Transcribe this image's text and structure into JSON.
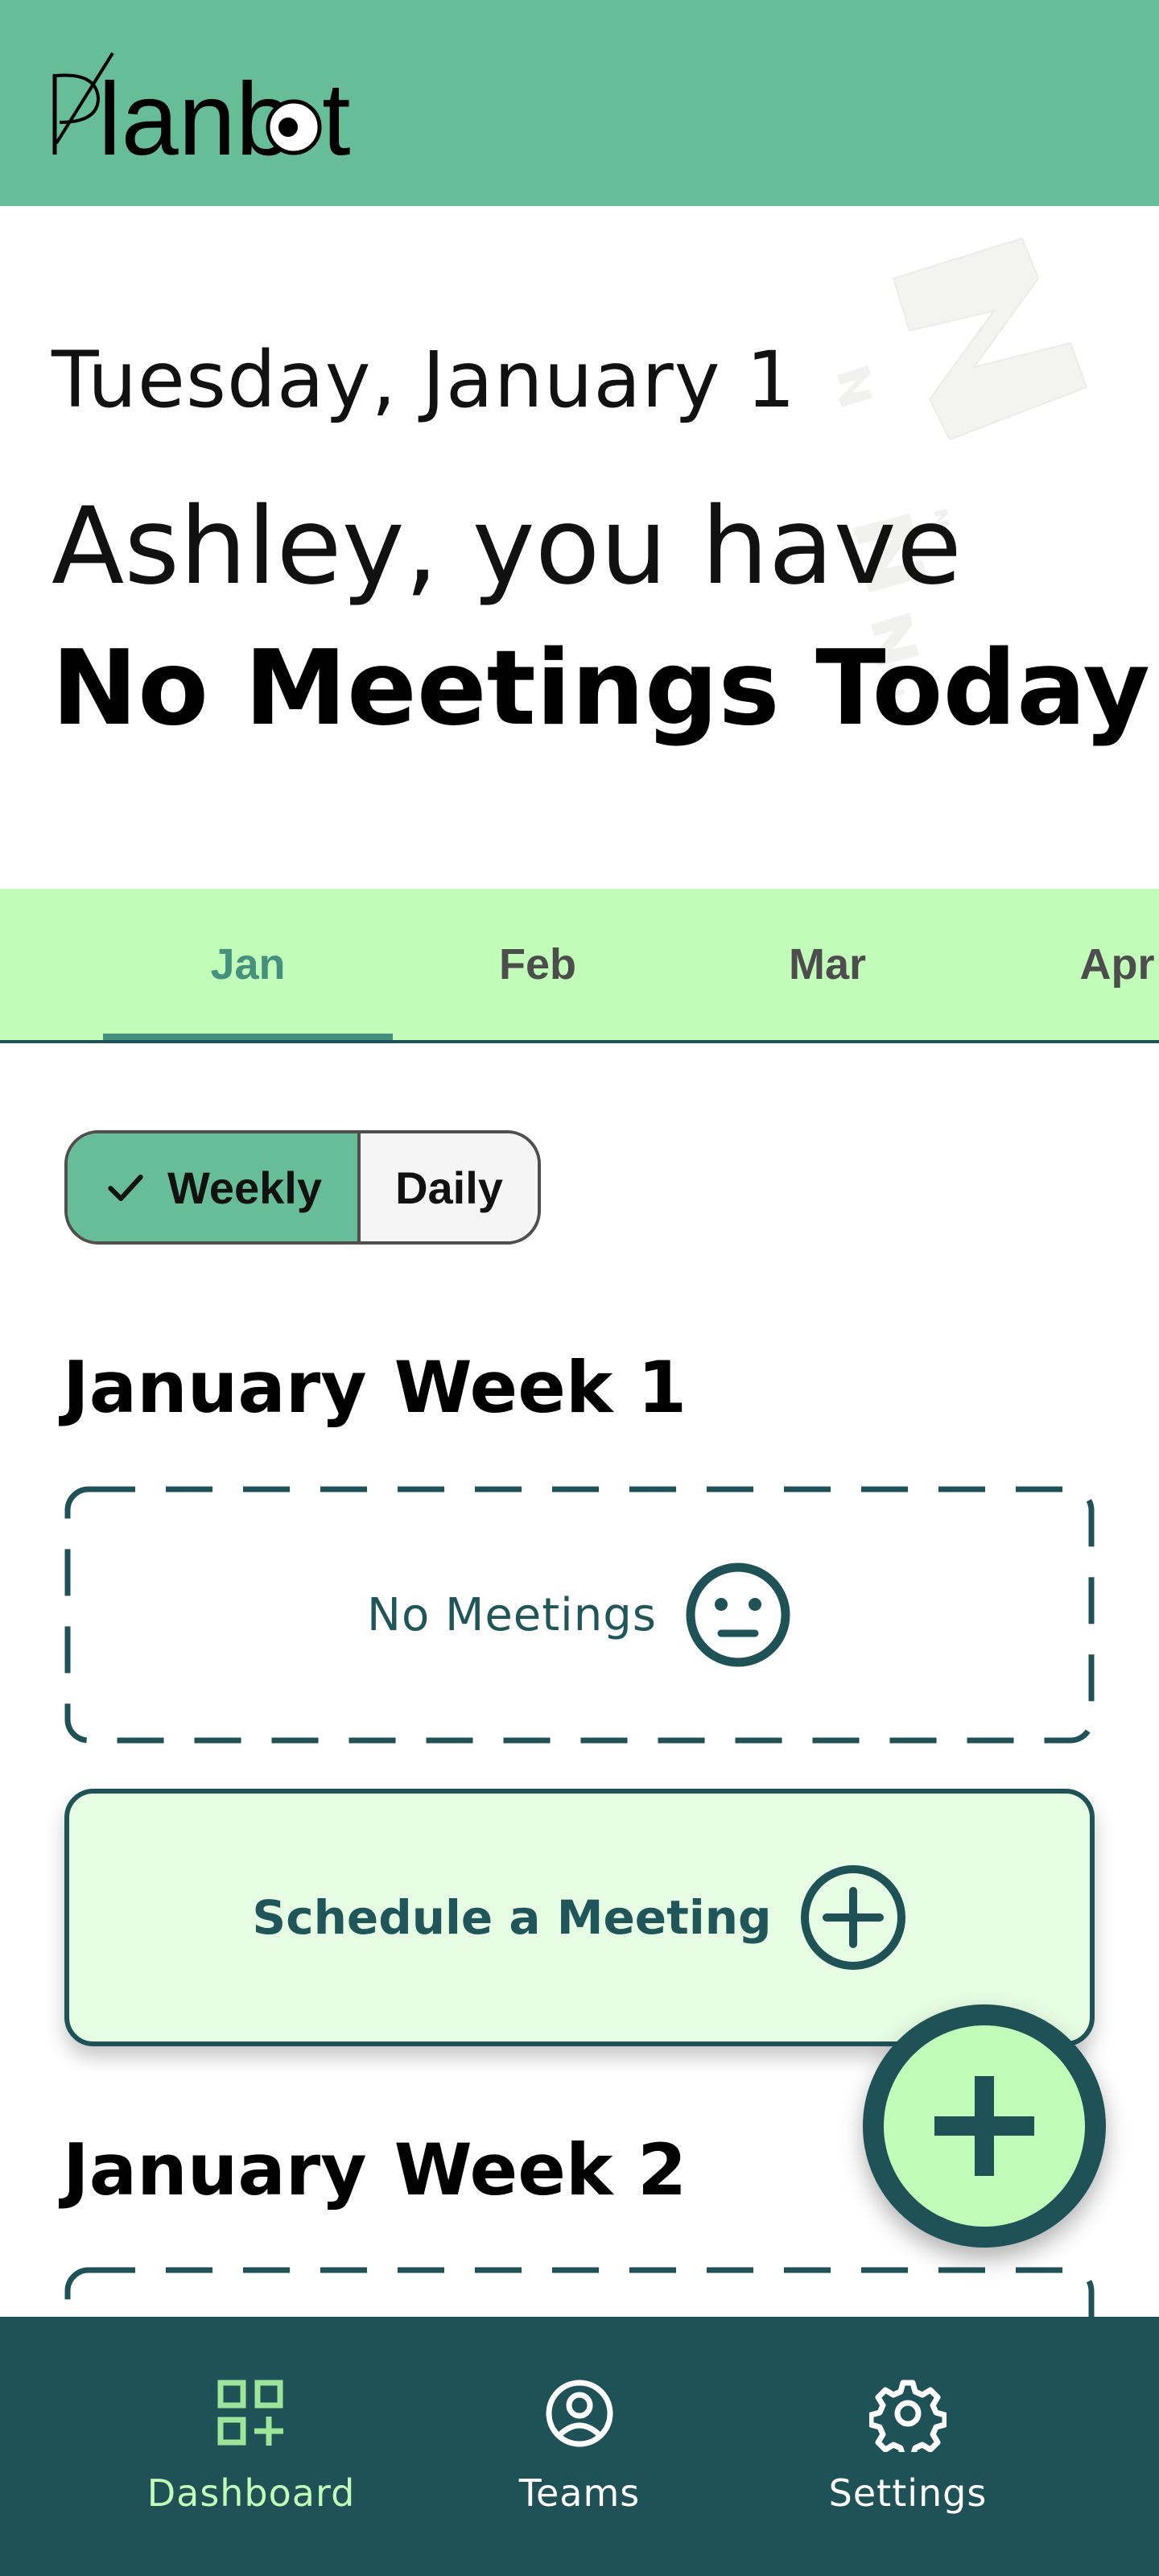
{
  "app": {
    "name": "Planbot"
  },
  "colors": {
    "primary": "#66bd98",
    "dark": "#1f5257",
    "light_green": "#c1fdb8",
    "pale_green": "#e6fde3"
  },
  "hero": {
    "date": "Tuesday, January 1",
    "greeting": "Ashley, you have",
    "status": "No Meetings Today"
  },
  "months": {
    "tabs": [
      {
        "label": "Jan",
        "selected": true
      },
      {
        "label": "Feb",
        "selected": false
      },
      {
        "label": "Mar",
        "selected": false
      },
      {
        "label": "Apr",
        "selected": false
      }
    ]
  },
  "view_toggle": {
    "weekly": "Weekly",
    "daily": "Daily",
    "selected": "Weekly",
    "check_icon": "check-icon"
  },
  "weeks": [
    {
      "month": "January",
      "week": "Week 1",
      "empty_text": "No Meetings",
      "empty_icon": "neutral-face-icon"
    },
    {
      "month": "January",
      "week": "Week 2"
    }
  ],
  "schedule": {
    "label": "Schedule a Meeting",
    "icon": "add-circle-icon"
  },
  "fab": {
    "icon": "plus-icon"
  },
  "bottom_nav": {
    "items": [
      {
        "label": "Dashboard",
        "icon": "dashboard-icon",
        "active": true
      },
      {
        "label": "Teams",
        "icon": "user-circle-icon",
        "active": false
      },
      {
        "label": "Settings",
        "icon": "gear-icon",
        "active": false
      }
    ]
  }
}
